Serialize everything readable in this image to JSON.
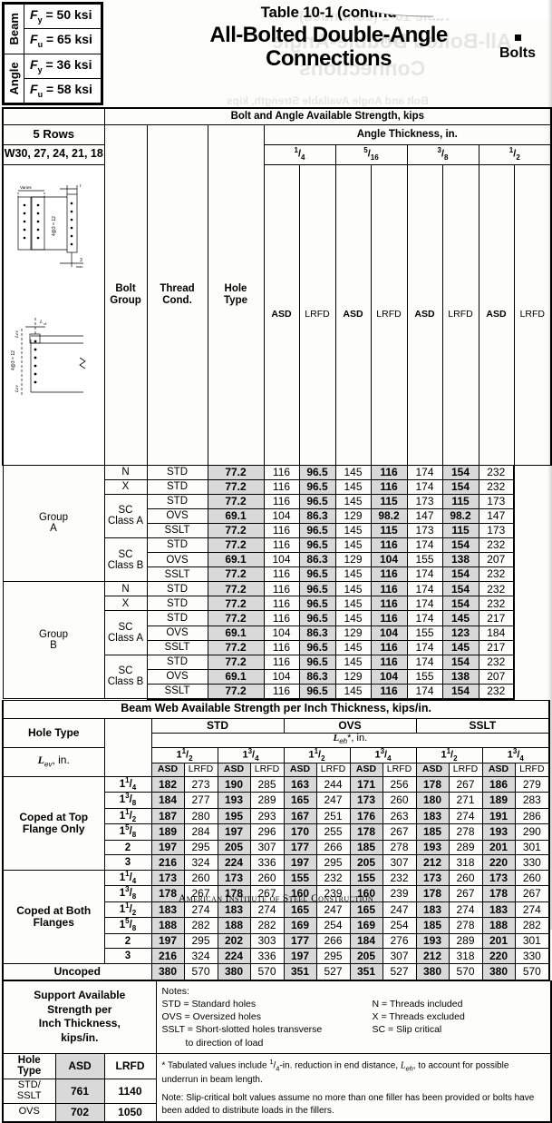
{
  "header": {
    "beam_label": "Beam",
    "angle_label": "Angle",
    "beam_fy": "Fy = 50 ksi",
    "beam_fu": "Fu = 65 ksi",
    "angle_fy": "Fy = 36 ksi",
    "angle_fu": "Fu = 58 ksi",
    "title_line1": "Table 10-1 (continu",
    "title_line2": "All-Bolted Double-Angle",
    "title_line3": "Connections",
    "bolts_label": "Bolts"
  },
  "bolt_section": {
    "band_title": "Bolt and Angle Available Strength, kips",
    "rows_label": "5 Rows",
    "shapes_label": "W30, 27, 24, 21, 18",
    "col_bolt_group": "Bolt Group",
    "col_thread_cond": "Thread Cond.",
    "col_hole_type": "Hole Type",
    "angle_thickness_title": "Angle Thickness, in.",
    "thicknesses": [
      "1/4",
      "5/16",
      "3/8",
      "1/2"
    ],
    "subheaders": [
      "ASD",
      "LRFD"
    ],
    "rows": [
      {
        "group": "Group A",
        "thread": "N",
        "hole": "STD",
        "vals": [
          "77.2",
          "116",
          "96.5",
          "145",
          "116",
          "174",
          "154",
          "232"
        ]
      },
      {
        "group": "",
        "thread": "X",
        "hole": "STD",
        "vals": [
          "77.2",
          "116",
          "96.5",
          "145",
          "116",
          "174",
          "154",
          "232"
        ]
      },
      {
        "group": "",
        "thread": "SC Class A",
        "hole": "STD",
        "vals": [
          "77.2",
          "116",
          "96.5",
          "145",
          "115",
          "173",
          "115",
          "173"
        ]
      },
      {
        "group": "",
        "thread": "",
        "hole": "OVS",
        "vals": [
          "69.1",
          "104",
          "86.3",
          "129",
          "98.2",
          "147",
          "98.2",
          "147"
        ]
      },
      {
        "group": "",
        "thread": "",
        "hole": "SSLT",
        "vals": [
          "77.2",
          "116",
          "96.5",
          "145",
          "115",
          "173",
          "115",
          "173"
        ]
      },
      {
        "group": "",
        "thread": "SC Class B",
        "hole": "STD",
        "vals": [
          "77.2",
          "116",
          "96.5",
          "145",
          "116",
          "174",
          "154",
          "232"
        ]
      },
      {
        "group": "",
        "thread": "",
        "hole": "OVS",
        "vals": [
          "69.1",
          "104",
          "86.3",
          "129",
          "104",
          "155",
          "138",
          "207"
        ]
      },
      {
        "group": "",
        "thread": "",
        "hole": "SSLT",
        "vals": [
          "77.2",
          "116",
          "96.5",
          "145",
          "116",
          "174",
          "154",
          "232"
        ]
      },
      {
        "group": "Group B",
        "thread": "N",
        "hole": "STD",
        "vals": [
          "77.2",
          "116",
          "96.5",
          "145",
          "116",
          "174",
          "154",
          "232"
        ]
      },
      {
        "group": "",
        "thread": "X",
        "hole": "STD",
        "vals": [
          "77.2",
          "116",
          "96.5",
          "145",
          "116",
          "174",
          "154",
          "232"
        ]
      },
      {
        "group": "",
        "thread": "SC Class A",
        "hole": "STD",
        "vals": [
          "77.2",
          "116",
          "96.5",
          "145",
          "116",
          "174",
          "145",
          "217"
        ]
      },
      {
        "group": "",
        "thread": "",
        "hole": "OVS",
        "vals": [
          "69.1",
          "104",
          "86.3",
          "129",
          "104",
          "155",
          "123",
          "184"
        ]
      },
      {
        "group": "",
        "thread": "",
        "hole": "SSLT",
        "vals": [
          "77.2",
          "116",
          "96.5",
          "145",
          "116",
          "174",
          "145",
          "217"
        ]
      },
      {
        "group": "",
        "thread": "SC Class B",
        "hole": "STD",
        "vals": [
          "77.2",
          "116",
          "96.5",
          "145",
          "116",
          "174",
          "154",
          "232"
        ]
      },
      {
        "group": "",
        "thread": "",
        "hole": "OVS",
        "vals": [
          "69.1",
          "104",
          "86.3",
          "129",
          "104",
          "155",
          "138",
          "207"
        ]
      },
      {
        "group": "",
        "thread": "",
        "hole": "SSLT",
        "vals": [
          "77.2",
          "116",
          "96.5",
          "145",
          "116",
          "174",
          "154",
          "232"
        ]
      }
    ]
  },
  "web_section": {
    "band_title": "Beam Web Available Strength per Inch Thickness, kips/in.",
    "hole_type_label": "Hole Type",
    "hole_types": [
      "STD",
      "OVS",
      "SSLT"
    ],
    "leh_label": "Leh*, in.",
    "lev_label": "Lev, in.",
    "leh_values": [
      "1 1/2",
      "1 3/4",
      "1 1/2",
      "1 3/4",
      "1 1/2",
      "1 3/4"
    ],
    "subheaders": [
      "ASD",
      "LRFD"
    ],
    "groups": [
      {
        "name": "Coped at Top Flange Only",
        "rows": [
          {
            "lev": "1 1/4",
            "vals": [
              "182",
              "273",
              "190",
              "285",
              "163",
              "244",
              "171",
              "256",
              "178",
              "267",
              "186",
              "279"
            ]
          },
          {
            "lev": "1 3/8",
            "vals": [
              "184",
              "277",
              "193",
              "289",
              "165",
              "247",
              "173",
              "260",
              "180",
              "271",
              "189",
              "283"
            ]
          },
          {
            "lev": "1 1/2",
            "vals": [
              "187",
              "280",
              "195",
              "293",
              "167",
              "251",
              "176",
              "263",
              "183",
              "274",
              "191",
              "286"
            ]
          },
          {
            "lev": "1 5/8",
            "vals": [
              "189",
              "284",
              "197",
              "296",
              "170",
              "255",
              "178",
              "267",
              "185",
              "278",
              "193",
              "290"
            ]
          },
          {
            "lev": "2",
            "vals": [
              "197",
              "295",
              "205",
              "307",
              "177",
              "266",
              "185",
              "278",
              "193",
              "289",
              "201",
              "301"
            ]
          },
          {
            "lev": "3",
            "vals": [
              "216",
              "324",
              "224",
              "336",
              "197",
              "295",
              "205",
              "307",
              "212",
              "318",
              "220",
              "330"
            ]
          }
        ]
      },
      {
        "name": "Coped at Both Flanges",
        "rows": [
          {
            "lev": "1 1/4",
            "vals": [
              "173",
              "260",
              "173",
              "260",
              "155",
              "232",
              "155",
              "232",
              "173",
              "260",
              "173",
              "260"
            ]
          },
          {
            "lev": "1 3/8",
            "vals": [
              "178",
              "267",
              "178",
              "267",
              "160",
              "239",
              "160",
              "239",
              "178",
              "267",
              "178",
              "267"
            ]
          },
          {
            "lev": "1 1/2",
            "vals": [
              "183",
              "274",
              "183",
              "274",
              "165",
              "247",
              "165",
              "247",
              "183",
              "274",
              "183",
              "274"
            ]
          },
          {
            "lev": "1 5/8",
            "vals": [
              "188",
              "282",
              "188",
              "282",
              "169",
              "254",
              "169",
              "254",
              "185",
              "278",
              "188",
              "282"
            ]
          },
          {
            "lev": "2",
            "vals": [
              "197",
              "295",
              "202",
              "303",
              "177",
              "266",
              "184",
              "276",
              "193",
              "289",
              "201",
              "301"
            ]
          },
          {
            "lev": "3",
            "vals": [
              "216",
              "324",
              "224",
              "336",
              "197",
              "295",
              "205",
              "307",
              "212",
              "318",
              "220",
              "330"
            ]
          }
        ]
      }
    ],
    "uncoped": {
      "label": "Uncoped",
      "vals": [
        "380",
        "570",
        "380",
        "570",
        "351",
        "527",
        "351",
        "527",
        "380",
        "570",
        "380",
        "570"
      ]
    }
  },
  "support_section": {
    "label": "Support Available Strength per Inch Thickness, kips/in.",
    "col_hole_type": "Hole Type",
    "col_asd": "ASD",
    "col_lrfd": "LRFD",
    "rows": [
      {
        "hole": "STD/ SSLT",
        "asd": "761",
        "lrfd": "1140"
      },
      {
        "hole": "OVS",
        "asd": "702",
        "lrfd": "1050"
      }
    ]
  },
  "notes": {
    "title": "Notes:",
    "left": [
      "STD = Standard holes",
      "OVS = Oversized holes",
      "SSLT = Short-slotted holes transverse",
      "to direction of load"
    ],
    "right": [
      "N = Threads included",
      "X = Threads excluded",
      "SC = Slip critical"
    ],
    "footnote": "* Tabulated values include 1/4-in. reduction in end distance, Leh, to account for possible underrun in beam length.",
    "note2": "Note: Slip-critical bolt values assume no more than one filler has been provided or bolts have been added to distribute loads in the fillers."
  },
  "footer": {
    "text": "American Institute of Steel Construction"
  },
  "diagrams": {
    "elevation_varies": "Varies",
    "elevation_spacing": "4 @ 3 = 12",
    "elevation_t": "t",
    "elevation_max": "3 max.",
    "section_leh": "Leh",
    "section_lev": "Lev",
    "section_spacing": "4 @ 3 = 12"
  }
}
